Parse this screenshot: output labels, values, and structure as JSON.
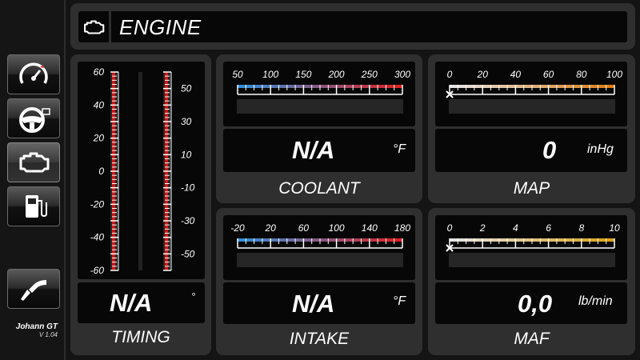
{
  "header": {
    "title": "ENGINE",
    "icon": "engine-icon"
  },
  "sidebar": {
    "items": [
      {
        "name": "dashboard",
        "icon": "speedometer-icon"
      },
      {
        "name": "driving",
        "icon": "steering-wheel-icon"
      },
      {
        "name": "engine",
        "icon": "engine-icon",
        "active": true
      },
      {
        "name": "fuel",
        "icon": "fuel-pump-icon"
      },
      {
        "name": "refuel",
        "icon": "fuel-nozzle-icon"
      }
    ],
    "brand": {
      "name": "Johann GT",
      "version": "V 1.04"
    }
  },
  "timing": {
    "label": "TIMING",
    "value": "N/A",
    "unit": "°",
    "left_scale": [
      "60",
      "40",
      "20",
      "0",
      "-20",
      "-40",
      "-60"
    ],
    "right_scale": [
      "50",
      "30",
      "10",
      "-10",
      "-30",
      "-50"
    ]
  },
  "coolant": {
    "label": "COOLANT",
    "value": "N/A",
    "unit": "°F",
    "scale": [
      "50",
      "100",
      "150",
      "200",
      "250",
      "300"
    ]
  },
  "intake": {
    "label": "INTAKE",
    "value": "N/A",
    "unit": "°F",
    "scale": [
      "-20",
      "20",
      "60",
      "100",
      "140",
      "180"
    ]
  },
  "map": {
    "label": "MAP",
    "value": "0",
    "unit": "inHg",
    "scale": [
      "0",
      "20",
      "40",
      "60",
      "80",
      "100"
    ]
  },
  "maf": {
    "label": "MAF",
    "value": "0,0",
    "unit": "lb/min",
    "scale": [
      "0",
      "2",
      "4",
      "6",
      "8",
      "10"
    ]
  },
  "colors": {
    "cold": "#2f8fe0",
    "hot": "#e02020",
    "orange": "#e07a10",
    "yellow": "#e0a010",
    "panel": "#2f2f2f"
  }
}
